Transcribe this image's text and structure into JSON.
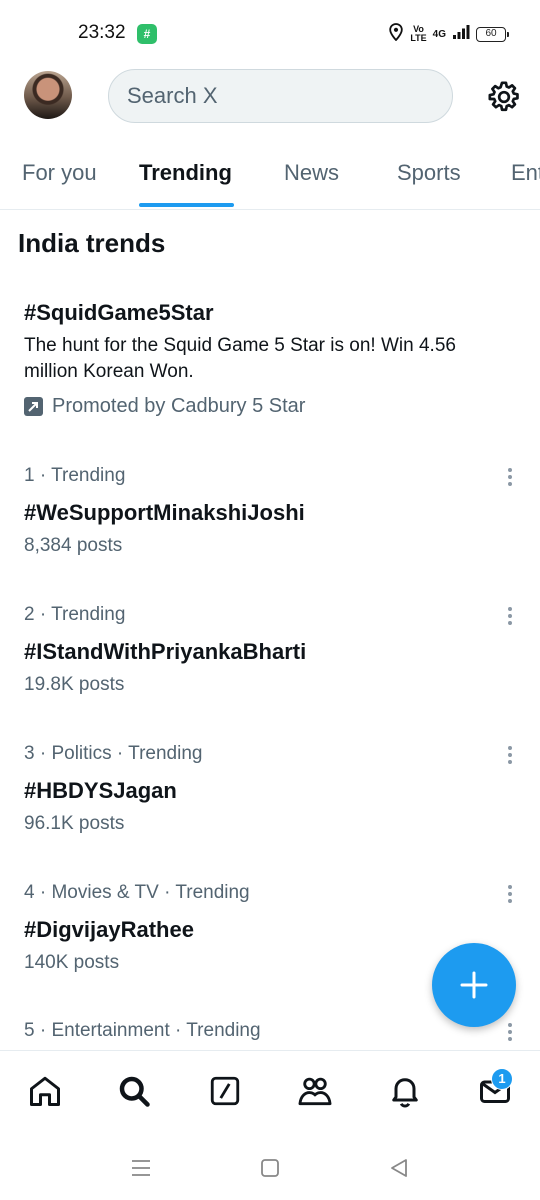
{
  "status_bar": {
    "time": "23:32",
    "app_icon": "#",
    "volte_top": "Vo",
    "volte_bottom": "LTE",
    "network": "4G",
    "battery": "60",
    "icons": [
      "location-icon",
      "signal-icon",
      "battery-icon"
    ]
  },
  "header": {
    "search_placeholder": "Search X",
    "settings_icon": "gear-icon"
  },
  "tabs": [
    {
      "label": "For you",
      "active": false
    },
    {
      "label": "Trending",
      "active": true
    },
    {
      "label": "News",
      "active": false
    },
    {
      "label": "Sports",
      "active": false
    },
    {
      "label": "Ent",
      "active": false
    }
  ],
  "section_title": "India trends",
  "promoted": {
    "name": "#SquidGame5Star",
    "description": "The hunt for the Squid Game 5 Star is on! Win 4.56 million Korean Won.",
    "label": "Promoted by Cadbury 5 Star"
  },
  "trends": [
    {
      "meta": "1 · Trending",
      "name": "#WeSupportMinakshiJoshi",
      "count": "8,384 posts"
    },
    {
      "meta": "2 · Trending",
      "name": "#IStandWithPriyankaBharti",
      "count": "19.8K posts"
    },
    {
      "meta": "3 · Politics · Trending",
      "name": "#HBDYSJagan",
      "count": "96.1K posts"
    },
    {
      "meta": "4 · Movies & TV · Trending",
      "name": "#DigvijayRathee",
      "count": "140K posts"
    },
    {
      "meta": "5 · Entertainment · Trending",
      "name": "",
      "count": ""
    }
  ],
  "bottom_nav": {
    "items": [
      "home-icon",
      "search-icon",
      "grok-icon",
      "communities-icon",
      "notifications-icon",
      "messages-icon"
    ],
    "messages_badge": "1"
  },
  "colors": {
    "accent": "#1d9bf0",
    "text": "#0f1419",
    "secondary": "#536471",
    "search_bg": "#eff3f4"
  }
}
